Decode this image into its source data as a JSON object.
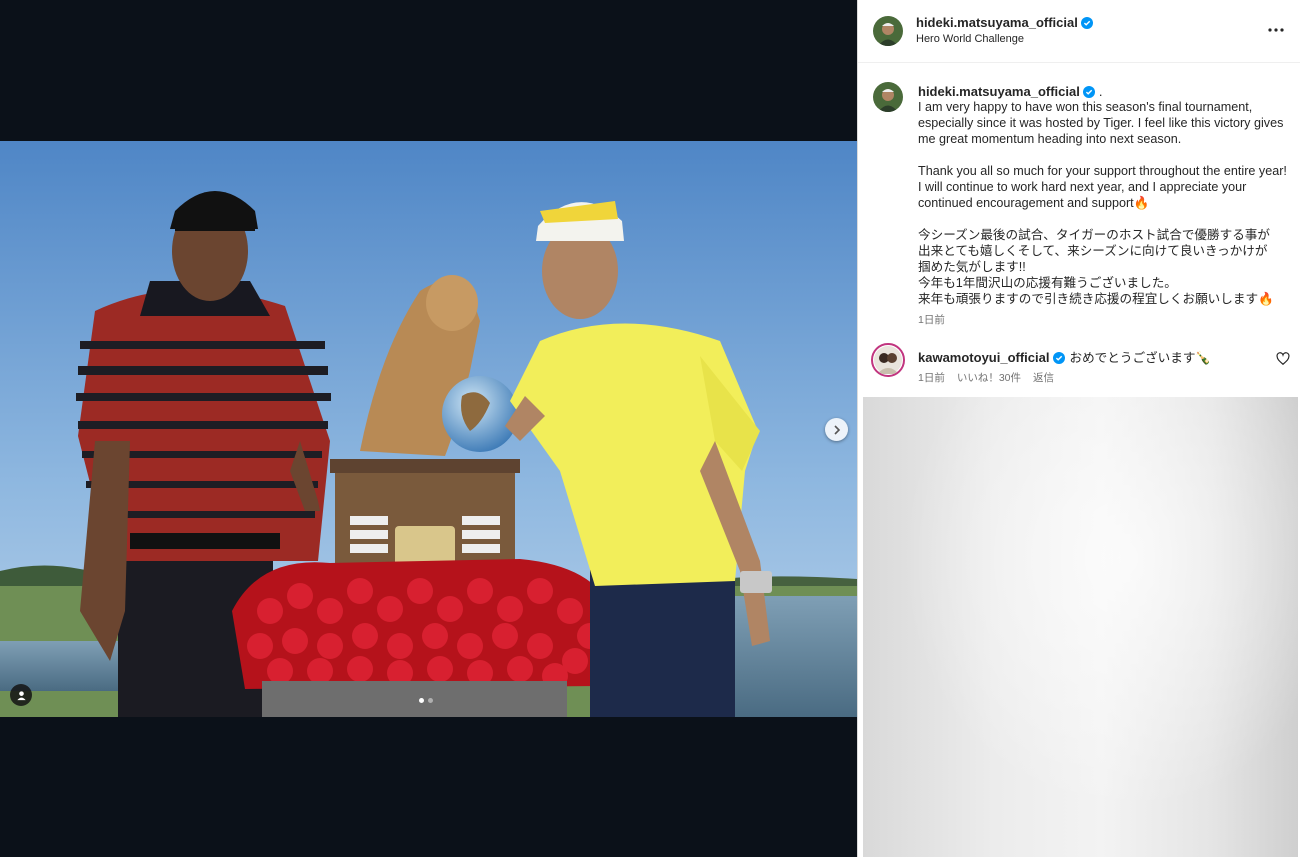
{
  "header": {
    "username": "hideki.matsuyama_official",
    "location": "Hero World Challenge"
  },
  "caption": {
    "username": "hideki.matsuyama_official",
    "dot": ".",
    "lines_en_1": [
      "I am very happy to have won this season's final tournament,",
      "especially since it was hosted by Tiger. I feel like this victory gives",
      "me great momentum heading into next season."
    ],
    "lines_en_2": [
      "Thank you all so much for your support throughout the entire year!",
      "I will continue to work hard next year, and I appreciate your",
      "continued encouragement and support🔥"
    ],
    "lines_ja": [
      "今シーズン最後の試合、タイガーのホスト試合で優勝する事が",
      "出来とても嬉しくそして、来シーズンに向けて良いきっかけが",
      "掴めた気がします!!",
      "今年も1年間沢山の応援有難うございました。",
      "来年も頑張りますので引き続き応援の程宜しくお願いします🔥"
    ],
    "time": "1日前"
  },
  "comment": {
    "username": "kawamotoyui_official",
    "text": "おめでとうございます🍾",
    "time": "1日前",
    "likes": "いいね！30件",
    "reply": "返信"
  },
  "carousel": {
    "current": 1,
    "total": 2
  },
  "colors": {
    "verified": "#0095f6",
    "story_ring": "#c1357f",
    "background": "#0b1119"
  },
  "icons": [
    "chevron-right-icon",
    "user-tag-icon",
    "more-icon",
    "heart-icon",
    "verified-badge-icon"
  ]
}
